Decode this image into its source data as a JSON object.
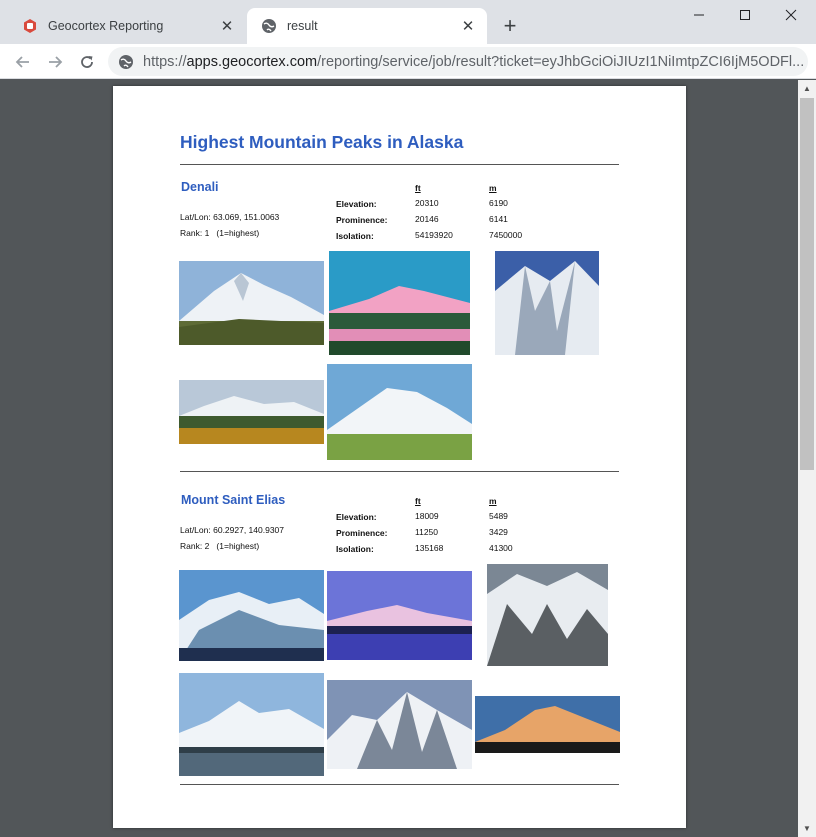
{
  "browser": {
    "tabs": [
      {
        "title": "Geocortex Reporting",
        "active": false
      },
      {
        "title": "result",
        "active": true
      }
    ],
    "url": {
      "scheme": "https://",
      "host": "apps.geocortex.com",
      "path": "/reporting/service/job/result?ticket=eyJhbGciOiJIUzI1NiImtpZCI6IjM5ODFl..."
    }
  },
  "report": {
    "title": "Highest Mountain Peaks in Alaska",
    "labels": {
      "latlon": "Lat/Lon:",
      "rank": "Rank:",
      "rank_note": "(1=highest)",
      "elevation": "Elevation:",
      "prominence": "Prominence:",
      "isolation": "Isolation:",
      "ft": "ft",
      "m": "m"
    },
    "peaks": [
      {
        "name": "Denali",
        "latlon": "63.069, 151.0063",
        "rank": "1",
        "elevation_ft": "20310",
        "elevation_m": "6190",
        "prominence_ft": "20146",
        "prominence_m": "6141",
        "isolation_ft": "54193920",
        "isolation_m": "7450000"
      },
      {
        "name": "Mount Saint Elias",
        "latlon": "60.2927, 140.9307",
        "rank": "2",
        "elevation_ft": "18009",
        "elevation_m": "5489",
        "prominence_ft": "11250",
        "prominence_m": "3429",
        "isolation_ft": "135168",
        "isolation_m": "41300"
      }
    ]
  },
  "colors": {
    "title_blue": "#2e5dbf",
    "viewer_bg": "#525659"
  }
}
